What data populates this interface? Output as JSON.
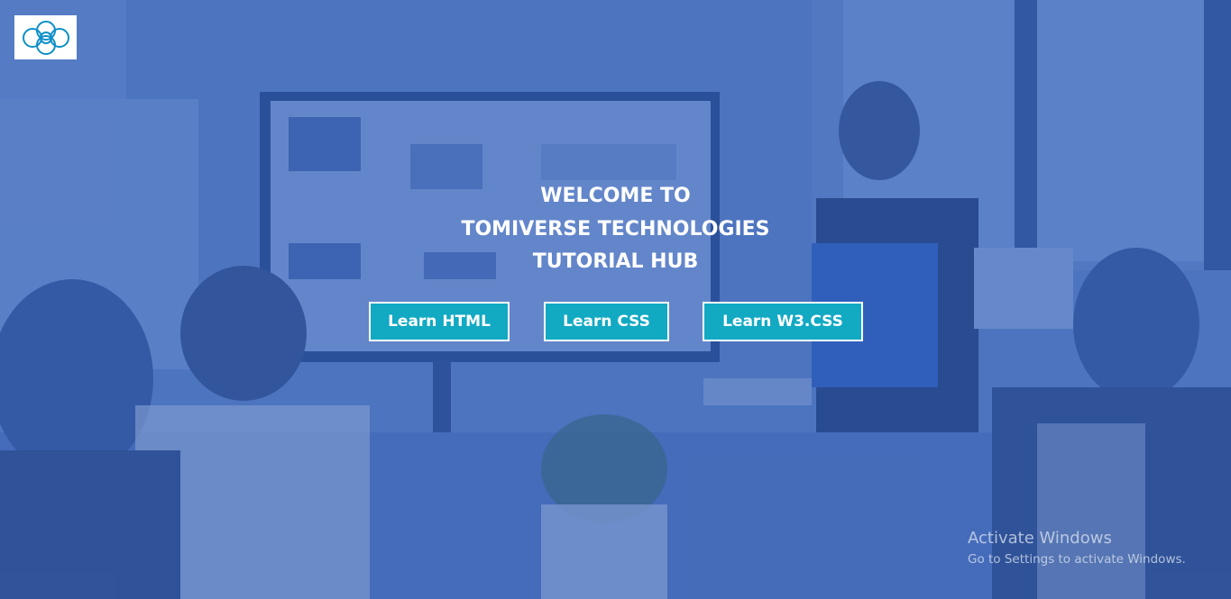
{
  "logo": {
    "icon": "interlocking-rings-icon",
    "color": "#0e8fc8"
  },
  "hero": {
    "title_lines": [
      "WELCOME TO",
      "TOMIVERSE TECHNOLOGIES",
      "TUTORIAL HUB"
    ],
    "overlay_color": "#3f62a8"
  },
  "buttons": {
    "html_label": "Learn HTML",
    "css_label": "Learn CSS",
    "w3css_label": "Learn W3.CSS",
    "accent_color": "#12a9c3"
  },
  "watermark": {
    "title": "Activate Windows",
    "subtitle": "Go to Settings to activate Windows."
  }
}
